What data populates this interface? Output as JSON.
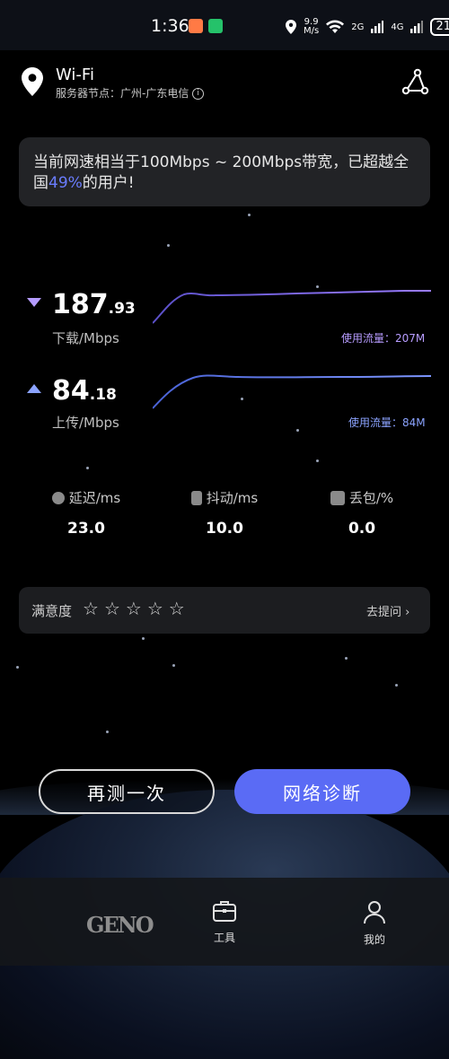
{
  "status_bar": {
    "time": "1:36",
    "net_speed_value": "9.9",
    "net_speed_unit": "M/s",
    "sig1": "2G",
    "sig2": "4G",
    "battery": "21"
  },
  "header": {
    "title": "Wi-Fi",
    "server_label": "服务器节点：广州-广东电信"
  },
  "banner": {
    "prefix": "当前网速相当于100Mbps ~ 200Mbps带宽，已超越全国",
    "percent": "49%",
    "suffix": "的用户!"
  },
  "download": {
    "int": "187",
    "dec": ".93",
    "label": "下载/Mbps",
    "usage": "使用流量：207M"
  },
  "upload": {
    "int": "84",
    "dec": ".18",
    "label": "上传/Mbps",
    "usage": "使用流量：84M"
  },
  "stats": {
    "latency": {
      "label": "延迟/ms",
      "value": "23.0"
    },
    "jitter": {
      "label": "抖动/ms",
      "value": "10.0"
    },
    "loss": {
      "label": "丢包/%",
      "value": "0.0"
    }
  },
  "satisfaction": {
    "label": "满意度",
    "stars": [
      "☆",
      "☆",
      "☆",
      "☆",
      "☆"
    ],
    "rating": 0,
    "max_rating": 5,
    "ask": "去提问 ›"
  },
  "buttons": {
    "retest": "再测一次",
    "diagnose": "网络诊断"
  },
  "nav": {
    "logo": "GENO",
    "tools": "工具",
    "me": "我的"
  },
  "colors": {
    "accent": "#5a6bf5",
    "download": "#b59cff",
    "upload": "#8ba3ff"
  }
}
